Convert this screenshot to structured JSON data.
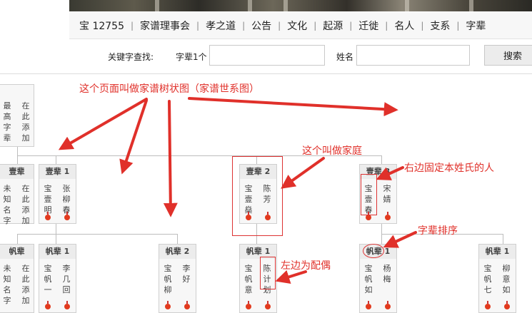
{
  "nav": {
    "items": [
      "宝 12755",
      "家谱理事会",
      "孝之道",
      "公告",
      "文化",
      "起源",
      "迁徙",
      "名人",
      "支系",
      "字辈"
    ]
  },
  "search": {
    "label": "关键字查找:",
    "generation_label": "字辈1个",
    "generation_value": "",
    "name_label": "姓名",
    "name_value": "",
    "button": "搜索"
  },
  "tree": {
    "top_card": {
      "left": "最高字辈",
      "right": "在此添加"
    },
    "gen1": [
      {
        "head": "壹辈",
        "left": "未知名字",
        "right": "在此添加"
      },
      {
        "head": "壹辈 1",
        "left": "宝壹明",
        "right": "张柳春"
      },
      {
        "head": "壹辈 2",
        "left": "宝壹燊",
        "right": "陈芳"
      },
      {
        "head": "壹辈 3",
        "left": "宝壹春",
        "right": "宋婧"
      }
    ],
    "gen2": [
      {
        "head": "帆辈",
        "left": "未知名字",
        "right": "在此添加"
      },
      {
        "head": "帆辈 1",
        "left": "宝帆一",
        "right": "李几回"
      },
      {
        "head": "帆辈 2",
        "left": "宝帆柳",
        "right": "李好"
      },
      {
        "head": "帆辈 1",
        "left": "宝帆意",
        "right": "陈计划"
      },
      {
        "head": "帆辈 1",
        "left": "宝帆如",
        "right": "杨梅"
      },
      {
        "head": "帆辈 1",
        "left": "宝帆七",
        "right": "柳意如"
      }
    ]
  },
  "annotations": {
    "tree_page": "这个页面叫做家谱树状图（家谱世系图）",
    "family": "这个叫做家庭",
    "right_fixed": "右边固定本姓氏的人",
    "generation_order": "字辈排序",
    "left_spouse": "左边为配偶"
  },
  "colors": {
    "annotation": "#e0302a",
    "marker": "#e23a1e"
  }
}
